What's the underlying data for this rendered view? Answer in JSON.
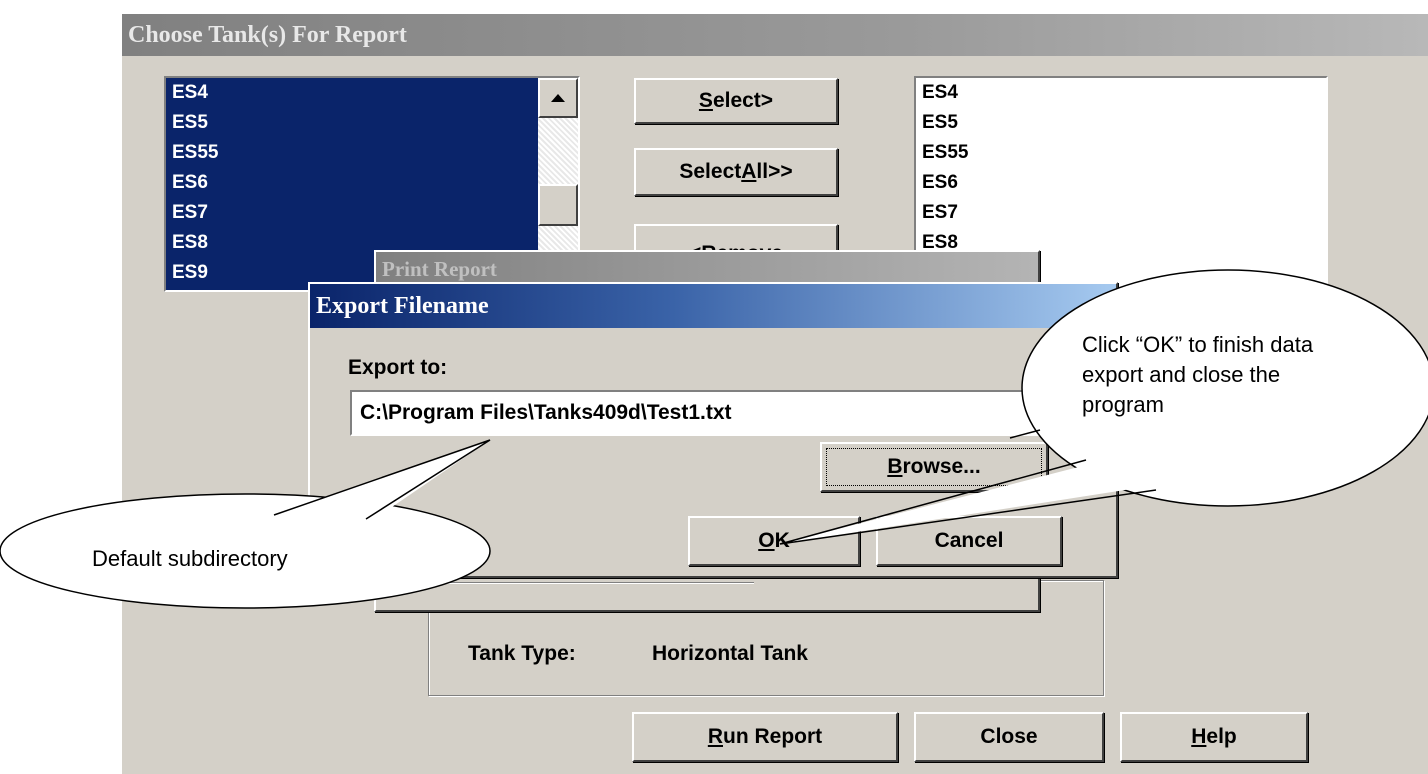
{
  "main_window": {
    "title": "Choose Tank(s) For Report",
    "left_list": [
      "ES4",
      "ES5",
      "ES55",
      "ES6",
      "ES7",
      "ES8",
      "ES9"
    ],
    "right_list": [
      "ES4",
      "ES5",
      "ES55",
      "ES6",
      "ES7",
      "ES8"
    ],
    "buttons": {
      "select": {
        "pre": "",
        "u": "S",
        "post": "elect>"
      },
      "select_all": {
        "pre": "Select ",
        "u": "A",
        "post": "ll>>"
      },
      "remove": "<Remove",
      "run_report": {
        "pre": "",
        "u": "R",
        "post": "un Report"
      },
      "close": "Close",
      "help": {
        "pre": "",
        "u": "H",
        "post": "elp"
      }
    },
    "tank_type_label": "Tank Type:",
    "tank_type_value": "Horizontal Tank"
  },
  "print_report_dialog": {
    "title": "Print Report"
  },
  "export_dialog": {
    "title": "Export Filename",
    "export_label": "Export to:",
    "path_value": "C:\\Program Files\\Tanks409d\\Test1.txt",
    "browse": {
      "pre": "",
      "u": "B",
      "post": "rowse..."
    },
    "ok": {
      "pre": "",
      "u": "O",
      "post": "K"
    },
    "cancel": "Cancel"
  },
  "callouts": {
    "left": "Default subdirectory",
    "right": "Click “OK” to finish data export and close the program"
  },
  "colors": {
    "list_selected_bg": "#0a246a",
    "title_gradient_start": "#0a246a",
    "title_gradient_end": "#a6caf0",
    "inactive_title": "#808080",
    "face": "#d4d0c8"
  }
}
